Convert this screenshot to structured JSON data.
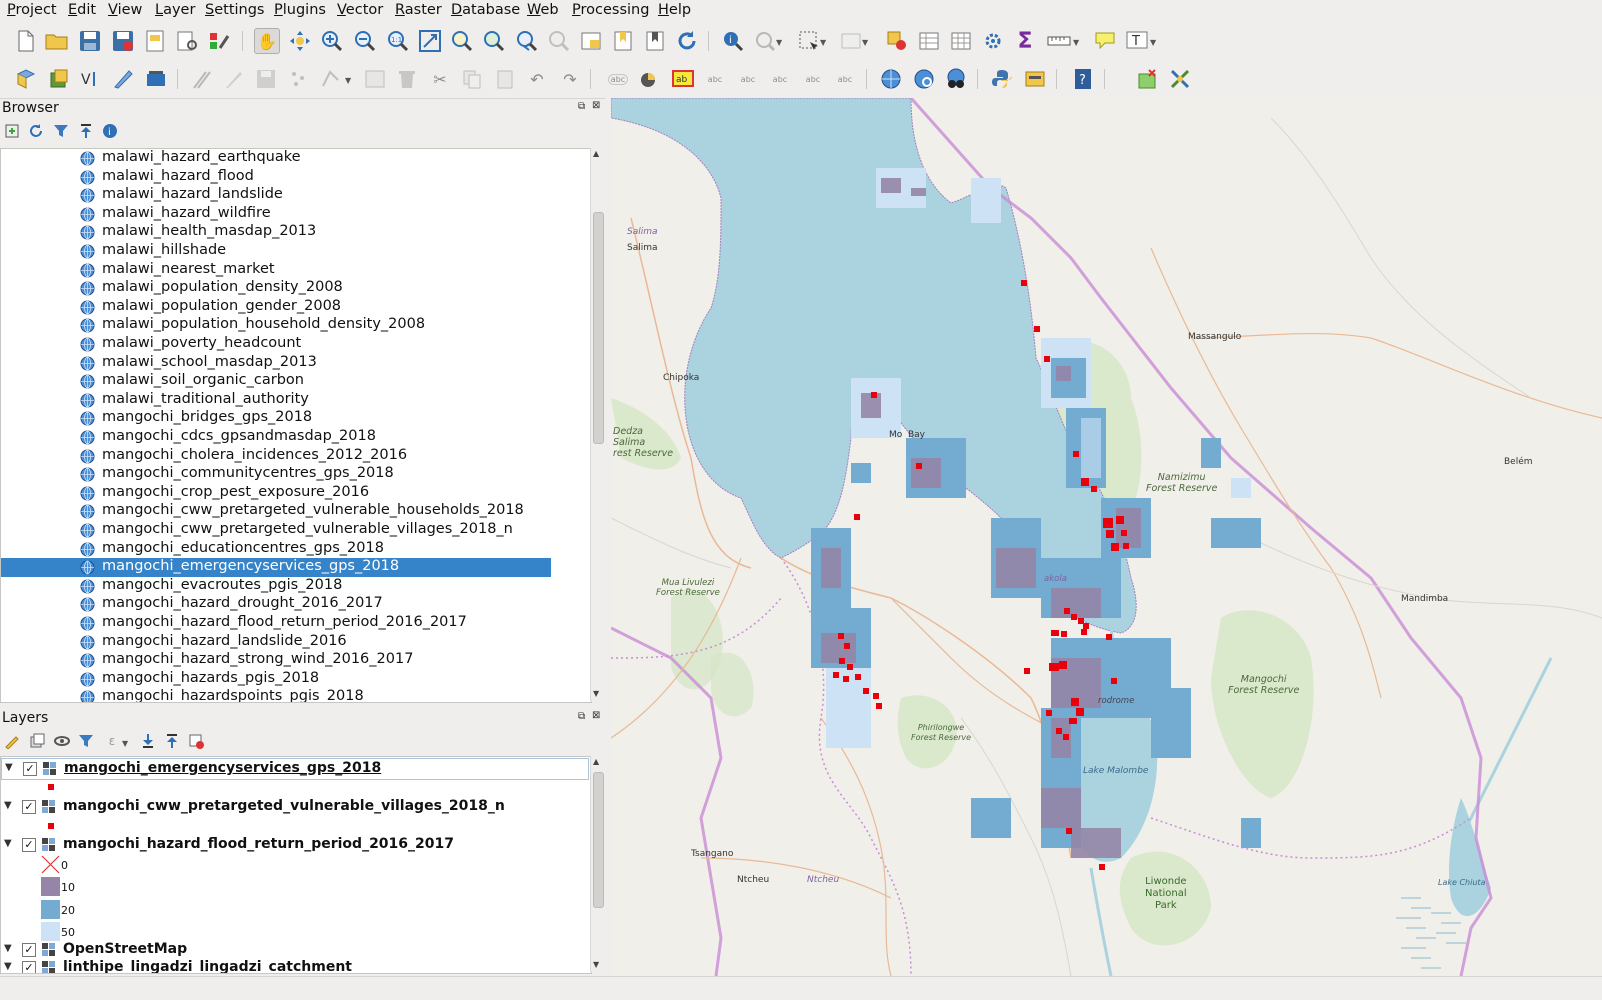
{
  "menu": [
    "Project",
    "Edit",
    "View",
    "Layer",
    "Settings",
    "Plugins",
    "Vector",
    "Raster",
    "Database",
    "Web",
    "Processing",
    "Help"
  ],
  "browser": {
    "title": "Browser",
    "items": [
      "malawi_hazard_earthquake",
      "malawi_hazard_flood",
      "malawi_hazard_landslide",
      "malawi_hazard_wildfire",
      "malawi_health_masdap_2013",
      "malawi_hillshade",
      "malawi_nearest_market",
      "malawi_population_density_2008",
      "malawi_population_gender_2008",
      "malawi_population_household_density_2008",
      "malawi_poverty_headcount",
      "malawi_school_masdap_2013",
      "malawi_soil_organic_carbon",
      "malawi_traditional_authority",
      "mangochi_bridges_gps_2018",
      "mangochi_cdcs_gpsandmasdap_2018",
      "mangochi_cholera_incidences_2012_2016",
      "mangochi_communitycentres_gps_2018",
      "mangochi_crop_pest_exposure_2016",
      "mangochi_cww_pretargeted_vulnerable_households_2018",
      "mangochi_cww_pretargeted_vulnerable_villages_2018_n",
      "mangochi_educationcentres_gps_2018",
      "mangochi_emergencyservices_gps_2018",
      "mangochi_evacroutes_pgis_2018",
      "mangochi_hazard_drought_2016_2017",
      "mangochi_hazard_flood_return_period_2016_2017",
      "mangochi_hazard_landslide_2016",
      "mangochi_hazard_strong_wind_2016_2017",
      "mangochi_hazards_pgis_2018",
      "mangochi_hazardspoints_pgis_2018"
    ],
    "selected_index": 22
  },
  "layers": {
    "title": "Layers",
    "items": [
      {
        "name": "mangochi_emergencyservices_gps_2018",
        "checked": "✓"
      },
      {
        "name": "mangochi_cww_pretargeted_vulnerable_villages_2018_n",
        "checked": "✓"
      },
      {
        "name": "mangochi_hazard_flood_return_period_2016_2017",
        "checked": "✓"
      },
      {
        "name": "OpenStreetMap",
        "checked": "✓"
      },
      {
        "name": "linthipe_lingadzi_lingadzi_catchment",
        "checked": "✓"
      }
    ],
    "legend": [
      {
        "label": "0",
        "color": "none"
      },
      {
        "label": "10",
        "color": "#9585a6"
      },
      {
        "label": "20",
        "color": "#74acd1"
      },
      {
        "label": "50",
        "color": "#cde3f5"
      }
    ],
    "point_color": "#e8000b"
  },
  "map": {
    "labels": {
      "salima_it": "Salima",
      "salima": "Salima",
      "chipoka": "Chipoka",
      "dedza": "Dedza\nSalima\nrest Reserve",
      "monkey_bay": "Mo  Bay",
      "massangulo": "Massangulo",
      "namizimu": "Namizimu\nForest Reserve",
      "belem": "Belém",
      "mandimba": "Mandimba",
      "mua": "Mua Livulezi\nForest Reserve",
      "makokola": "akola",
      "mangochi_fr": "Mangochi\nForest Reserve",
      "phirilongwe": "Phirilongwe\nForest Reserve",
      "aerodrome": "rodrome",
      "malombe": "Lake Malombe",
      "tsangano": "Tsangano",
      "ntcheu": "Ntcheu",
      "ntcheu_it": "Ntcheu",
      "liwonde": "Liwonde\nNational\nPark",
      "lake_chiuta": "Lake Chiuta"
    },
    "colors": {
      "water": "#aad3df",
      "land": "#f1efe9",
      "forest": "#d4e6c4",
      "boundary": "#c98bd6"
    }
  }
}
